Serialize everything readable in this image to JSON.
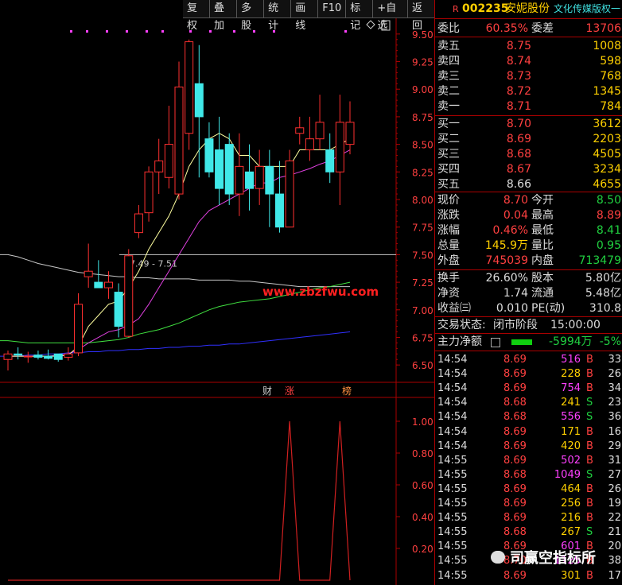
{
  "toolbar": [
    "复权",
    "叠加",
    "多股",
    "统计",
    "画线",
    "F10",
    "标记",
    "+自选",
    "返回"
  ],
  "price_axis": [
    "9.50",
    "9.25",
    "9.00",
    "8.75",
    "8.50",
    "8.25",
    "8.00",
    "7.75",
    "7.50",
    "7.25",
    "7.00",
    "6.75",
    "6.50"
  ],
  "indicator_axis": [
    "1.00",
    "0.80",
    "0.60",
    "0.40",
    "0.20"
  ],
  "annotation_range": "7.49 - 7.51",
  "event_markers": [
    "财",
    "涨",
    "榜"
  ],
  "watermark_url": "www.zbzfwu.com",
  "header": {
    "r": "R",
    "code": "002235",
    "name": "安妮股份",
    "sector": "文化传媒版权一"
  },
  "weibi": {
    "l1": "委比",
    "v1": "60.35%",
    "l2": "委差",
    "v2": "13706"
  },
  "asks": [
    {
      "label": "卖五",
      "price": "8.75",
      "vol": "1008"
    },
    {
      "label": "卖四",
      "price": "8.74",
      "vol": "598"
    },
    {
      "label": "卖三",
      "price": "8.73",
      "vol": "768"
    },
    {
      "label": "卖二",
      "price": "8.72",
      "vol": "1345"
    },
    {
      "label": "卖一",
      "price": "8.71",
      "vol": "784"
    }
  ],
  "bids": [
    {
      "label": "买一",
      "price": "8.70",
      "vol": "3612"
    },
    {
      "label": "买二",
      "price": "8.69",
      "vol": "2203"
    },
    {
      "label": "买三",
      "price": "8.68",
      "vol": "4505"
    },
    {
      "label": "买四",
      "price": "8.67",
      "vol": "3234"
    },
    {
      "label": "买五",
      "price": "8.66",
      "vol": "4655"
    }
  ],
  "stats": [
    {
      "l1": "现价",
      "v1": "8.70",
      "c1": "red",
      "l2": "今开",
      "v2": "8.50",
      "c2": "green"
    },
    {
      "l1": "涨跌",
      "v1": "0.04",
      "c1": "red",
      "l2": "最高",
      "v2": "8.89",
      "c2": "red"
    },
    {
      "l1": "涨幅",
      "v1": "0.46%",
      "c1": "red",
      "l2": "最低",
      "v2": "8.41",
      "c2": "green"
    },
    {
      "l1": "总量",
      "v1": "145.9万",
      "c1": "yellow",
      "l2": "量比",
      "v2": "0.95",
      "c2": "green"
    },
    {
      "l1": "外盘",
      "v1": "745039",
      "c1": "red",
      "l2": "内盘",
      "v2": "713479",
      "c2": "green"
    }
  ],
  "stats2": [
    {
      "l1": "换手",
      "v1": "26.60%",
      "l2": "股本",
      "v2": "5.80亿"
    },
    {
      "l1": "净资",
      "v1": "1.74",
      "l2": "流通",
      "v2": "5.48亿"
    },
    {
      "l1": "收益㈢",
      "v1": "0.010",
      "l2": "PE(动)",
      "v2": "310.8"
    }
  ],
  "trade_status": {
    "label": "交易状态:",
    "status": "闭市阶段",
    "time": "15:00:00"
  },
  "main_flow": {
    "label": "主力净额",
    "value": "-5994万",
    "pct": "-5%"
  },
  "ticks": [
    {
      "t": "14:54",
      "p": "8.69",
      "v": "516",
      "s": "B",
      "n": "33"
    },
    {
      "t": "14:54",
      "p": "8.69",
      "v": "228",
      "s": "B",
      "n": "26"
    },
    {
      "t": "14:54",
      "p": "8.69",
      "v": "754",
      "s": "B",
      "n": "34"
    },
    {
      "t": "14:54",
      "p": "8.68",
      "v": "241",
      "s": "S",
      "n": "23"
    },
    {
      "t": "14:54",
      "p": "8.68",
      "v": "556",
      "s": "S",
      "n": "36"
    },
    {
      "t": "14:54",
      "p": "8.69",
      "v": "171",
      "s": "B",
      "n": "16"
    },
    {
      "t": "14:54",
      "p": "8.69",
      "v": "420",
      "s": "B",
      "n": "29"
    },
    {
      "t": "14:55",
      "p": "8.69",
      "v": "502",
      "s": "B",
      "n": "31"
    },
    {
      "t": "14:55",
      "p": "8.68",
      "v": "1049",
      "s": "S",
      "n": "27"
    },
    {
      "t": "14:55",
      "p": "8.69",
      "v": "464",
      "s": "B",
      "n": "26"
    },
    {
      "t": "14:55",
      "p": "8.69",
      "v": "256",
      "s": "B",
      "n": "19"
    },
    {
      "t": "14:55",
      "p": "8.69",
      "v": "216",
      "s": "B",
      "n": "22"
    },
    {
      "t": "14:55",
      "p": "8.68",
      "v": "267",
      "s": "S",
      "n": "21"
    },
    {
      "t": "14:55",
      "p": "8.69",
      "v": "601",
      "s": "B",
      "n": "20"
    },
    {
      "t": "14:55",
      "p": "8.70",
      "v": "1125",
      "s": "B",
      "n": "38"
    },
    {
      "t": "14:55",
      "p": "8.69",
      "v": "301",
      "s": "B",
      "n": "17"
    }
  ],
  "brand": "司赢空指标所",
  "chart_data": {
    "type": "candlestick",
    "ylim": [
      6.35,
      9.65
    ],
    "candles": [
      {
        "o": 6.55,
        "h": 6.63,
        "l": 6.45,
        "c": 6.6
      },
      {
        "o": 6.6,
        "h": 6.66,
        "l": 6.55,
        "c": 6.59
      },
      {
        "o": 6.58,
        "h": 6.62,
        "l": 6.52,
        "c": 6.58
      },
      {
        "o": 6.59,
        "h": 6.63,
        "l": 6.55,
        "c": 6.57
      },
      {
        "o": 6.58,
        "h": 6.64,
        "l": 6.55,
        "c": 6.56
      },
      {
        "o": 6.6,
        "h": 6.6,
        "l": 6.53,
        "c": 6.55
      },
      {
        "o": 6.57,
        "h": 6.66,
        "l": 6.54,
        "c": 6.6
      },
      {
        "o": 6.61,
        "h": 7.15,
        "l": 6.58,
        "c": 7.05
      },
      {
        "o": 7.3,
        "h": 7.6,
        "l": 7.2,
        "c": 7.35
      },
      {
        "o": 7.25,
        "h": 7.45,
        "l": 7.2,
        "c": 7.2
      },
      {
        "o": 7.2,
        "h": 7.35,
        "l": 7.1,
        "c": 7.25
      },
      {
        "o": 7.16,
        "h": 7.24,
        "l": 6.75,
        "c": 6.85
      },
      {
        "o": 6.76,
        "h": 7.55,
        "l": 6.75,
        "c": 7.49
      },
      {
        "o": 7.7,
        "h": 7.95,
        "l": 7.65,
        "c": 7.87
      },
      {
        "o": 7.88,
        "h": 8.3,
        "l": 7.8,
        "c": 8.25
      },
      {
        "o": 8.25,
        "h": 8.55,
        "l": 8.05,
        "c": 8.35
      },
      {
        "o": 8.2,
        "h": 8.85,
        "l": 8.1,
        "c": 8.5
      },
      {
        "o": 8.05,
        "h": 9.25,
        "l": 8.0,
        "c": 9.02
      },
      {
        "o": 8.6,
        "h": 9.45,
        "l": 8.45,
        "c": 9.43
      },
      {
        "o": 9.05,
        "h": 9.4,
        "l": 8.2,
        "c": 8.75
      },
      {
        "o": 8.55,
        "h": 8.7,
        "l": 8.2,
        "c": 8.25
      },
      {
        "o": 8.45,
        "h": 8.75,
        "l": 7.95,
        "c": 8.1
      },
      {
        "o": 8.5,
        "h": 8.6,
        "l": 7.95,
        "c": 8.05
      },
      {
        "o": 8.05,
        "h": 8.6,
        "l": 7.85,
        "c": 8.3
      },
      {
        "o": 8.25,
        "h": 8.5,
        "l": 7.9,
        "c": 8.1
      },
      {
        "o": 8.1,
        "h": 8.45,
        "l": 7.95,
        "c": 8.3
      },
      {
        "o": 8.3,
        "h": 8.45,
        "l": 7.75,
        "c": 8.05
      },
      {
        "o": 8.05,
        "h": 8.35,
        "l": 7.7,
        "c": 7.75
      },
      {
        "o": 7.75,
        "h": 8.45,
        "l": 7.8,
        "c": 8.35
      },
      {
        "o": 8.6,
        "h": 8.75,
        "l": 8.5,
        "c": 8.65
      },
      {
        "o": 8.45,
        "h": 8.75,
        "l": 8.35,
        "c": 8.55
      },
      {
        "o": 8.55,
        "h": 8.95,
        "l": 8.45,
        "c": 8.7
      },
      {
        "o": 8.45,
        "h": 8.6,
        "l": 8.15,
        "c": 8.25
      },
      {
        "o": 8.25,
        "h": 8.95,
        "l": 7.95,
        "c": 8.7
      },
      {
        "o": 8.5,
        "h": 8.89,
        "l": 8.41,
        "c": 8.7
      }
    ],
    "ma_yellow": [
      6.58,
      6.58,
      6.58,
      6.58,
      6.58,
      6.58,
      6.59,
      6.67,
      6.85,
      6.95,
      7.05,
      7.08,
      7.2,
      7.35,
      7.55,
      7.7,
      7.85,
      8.05,
      8.3,
      8.45,
      8.55,
      8.6,
      8.55,
      8.4,
      8.4,
      8.3,
      8.3,
      8.3,
      8.3,
      8.45,
      8.45,
      8.45,
      8.45,
      8.5,
      8.55
    ],
    "ma_magenta": [
      6.58,
      6.58,
      6.58,
      6.58,
      6.58,
      6.59,
      6.6,
      6.64,
      6.7,
      6.75,
      6.8,
      6.82,
      6.86,
      6.92,
      7.05,
      7.2,
      7.35,
      7.5,
      7.65,
      7.8,
      7.9,
      7.95,
      8.0,
      8.05,
      8.1,
      8.15,
      8.15,
      8.2,
      8.22,
      8.25,
      8.28,
      8.32,
      8.35,
      8.4,
      8.45
    ],
    "ma_white": [
      7.5,
      7.48,
      7.45,
      7.42,
      7.4,
      7.38,
      7.36,
      7.34,
      7.33,
      7.32,
      7.31,
      7.3,
      7.3,
      7.29,
      7.29,
      7.28,
      7.28,
      7.28,
      7.28,
      7.27,
      7.27,
      7.27,
      7.27,
      7.26,
      7.26,
      7.25,
      7.24,
      7.23,
      7.22,
      7.21,
      7.21,
      7.21,
      7.21,
      7.21,
      7.21
    ],
    "ma_green": [
      6.72,
      6.71,
      6.7,
      6.7,
      6.7,
      6.7,
      6.7,
      6.7,
      6.7,
      6.71,
      6.72,
      6.73,
      6.75,
      6.78,
      6.8,
      6.82,
      6.85,
      6.88,
      6.92,
      6.96,
      7.0,
      7.03,
      7.05,
      7.07,
      7.08,
      7.09,
      7.1,
      7.12,
      7.14,
      7.16,
      7.18,
      7.2,
      7.21,
      7.23,
      7.25
    ],
    "ma_blue": [
      6.58,
      6.58,
      6.59,
      6.59,
      6.6,
      6.6,
      6.61,
      6.61,
      6.62,
      6.62,
      6.63,
      6.63,
      6.64,
      6.64,
      6.65,
      6.65,
      6.66,
      6.66,
      6.67,
      6.67,
      6.68,
      6.68,
      6.69,
      6.69,
      6.7,
      6.71,
      6.72,
      6.73,
      6.74,
      6.75,
      6.76,
      6.77,
      6.78,
      6.79,
      6.8
    ],
    "indicator": {
      "ylim": [
        0,
        1.1
      ],
      "values": [
        0,
        0,
        0,
        0,
        0,
        0,
        0,
        0,
        0,
        0,
        0,
        0,
        0,
        0,
        0,
        0,
        0,
        0,
        0,
        0,
        0,
        0,
        0,
        0,
        0,
        0,
        0,
        0,
        1,
        0,
        0,
        0,
        0,
        1,
        0
      ]
    },
    "colors": {
      "up": "#ff3030",
      "down": "#40e8e8",
      "yellow": "#ffffa0",
      "magenta": "#e040e0",
      "white": "#c8c8c8",
      "green": "#40e040",
      "blue": "#3030ff",
      "indicator": "#d02020"
    }
  }
}
